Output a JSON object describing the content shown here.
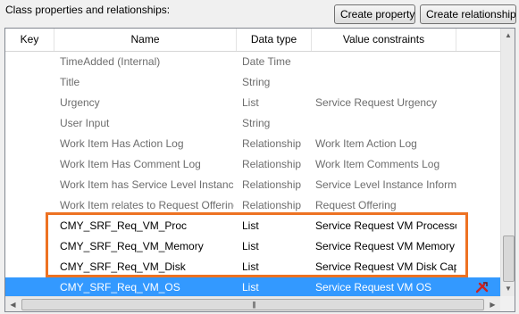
{
  "section_label": "Class properties and relationships:",
  "buttons": {
    "create_property": "Create property...",
    "create_relationship": "Create relationship..."
  },
  "columns": {
    "key": "Key",
    "name": "Name",
    "data_type": "Data type",
    "value_constraints": "Value constraints"
  },
  "rows": [
    {
      "name": "TimeAdded (Internal)",
      "type": "Date Time",
      "constraint": ""
    },
    {
      "name": "Title",
      "type": "String",
      "constraint": ""
    },
    {
      "name": "Urgency",
      "type": "List",
      "constraint": "Service Request Urgency"
    },
    {
      "name": "User Input",
      "type": "String",
      "constraint": ""
    },
    {
      "name": "Work Item Has Action Log",
      "type": "Relationship",
      "constraint": "Work Item Action Log"
    },
    {
      "name": "Work Item Has Comment Log",
      "type": "Relationship",
      "constraint": "Work Item Comments Log"
    },
    {
      "name": "Work Item has Service Level Instance I",
      "type": "Relationship",
      "constraint": "Service Level Instance Informati"
    },
    {
      "name": "Work Item relates to Request Offering",
      "type": "Relationship",
      "constraint": "Request Offering"
    },
    {
      "name": "CMY_SRF_Req_VM_Proc",
      "type": "List",
      "constraint": "Service Request VM Processor"
    },
    {
      "name": "CMY_SRF_Req_VM_Memory",
      "type": "List",
      "constraint": "Service Request VM Memory"
    },
    {
      "name": "CMY_SRF_Req_VM_Disk",
      "type": "List",
      "constraint": "Service Request VM Disk Capac"
    },
    {
      "name": "CMY_SRF_Req_VM_OS",
      "type": "List",
      "constraint": "Service Request VM OS"
    }
  ],
  "icons": {
    "delete": "delete-property-icon",
    "scroll_up": "scroll-up-icon",
    "scroll_down": "scroll-down-icon",
    "scroll_left": "scroll-left-icon",
    "scroll_right": "scroll-right-icon"
  },
  "colors": {
    "selection": "#3399ff",
    "highlight_border": "#ed7222",
    "inherited_text": "#6d6d6d",
    "delete_icon": "#cc2222"
  }
}
